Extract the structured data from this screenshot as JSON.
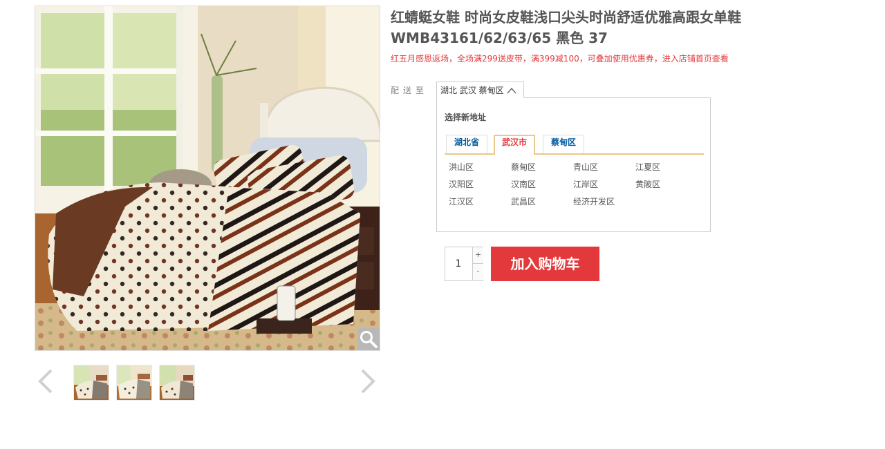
{
  "product": {
    "title": "红蜻蜓女鞋 时尚女皮鞋浅口尖头时尚舒适优雅高跟女单鞋 WMB43161/62/63/65 黑色 37",
    "promo": "红五月感恩返场，全场满299送皮带，满399减100，可叠加使用优惠券，进入店铺首页查看"
  },
  "gallery": {
    "main_image_icon": "bedroom-photo",
    "zoom_icon": "magnifier-icon",
    "prev_icon": "chevron-left-icon",
    "next_icon": "chevron-right-icon",
    "thumbnail_count": 3
  },
  "shipping": {
    "label": "配送至",
    "selected": "湖北 武汉 蔡甸区",
    "panel_title": "选择新地址",
    "tabs": [
      "湖北省",
      "武汉市",
      "蔡甸区"
    ],
    "active_tab": "武汉市",
    "areas": [
      "洪山区",
      "蔡甸区",
      "青山区",
      "江夏区",
      "汉阳区",
      "汉南区",
      "江岸区",
      "黄陂区",
      "江汉区",
      "武昌区",
      "经济开发区"
    ]
  },
  "buy": {
    "quantity": "1",
    "plus": "+",
    "minus": "-",
    "add_to_cart": "加入购物车"
  },
  "colors": {
    "accent_red": "#e4393c",
    "tab_border": "#e9c88c",
    "link_blue": "#005aa0"
  }
}
